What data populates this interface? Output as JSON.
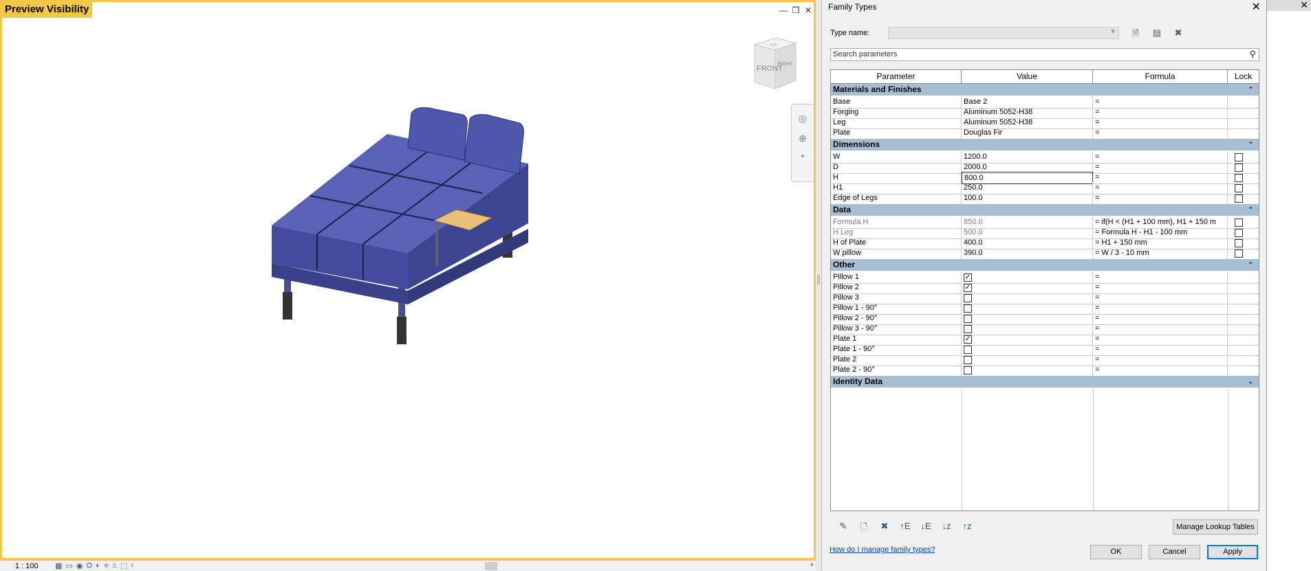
{
  "viewport": {
    "label": "Preview Visibility",
    "controls": [
      "—",
      "❐",
      "✕"
    ],
    "viewcube_front": "FRONT",
    "viewcube_right": "RIGHT",
    "viewcube_top": "TOP"
  },
  "statusbar": {
    "scale": "1 : 100",
    "icons": [
      "▦",
      "▭",
      "◉",
      "⛭",
      "◐",
      "⟡",
      "⌂",
      "⬚",
      "‹"
    ],
    "arrow_right": "›"
  },
  "dialog": {
    "title": "Family Types",
    "close": "✕",
    "type_name_label": "Type name:",
    "type_name_value": "",
    "type_tools": [
      "🗎",
      "▤",
      "✖"
    ],
    "search_placeholder": "Search parameters",
    "headers": {
      "parameter": "Parameter",
      "value": "Value",
      "formula": "Formula",
      "lock": "Lock"
    },
    "groups": [
      {
        "name": "Materials and Finishes",
        "arrow": "⌃",
        "rows": [
          {
            "param": "Base",
            "value": "Base 2",
            "formula": "=",
            "lock": null
          },
          {
            "param": "Forging",
            "value": "Aluminum 5052-H38",
            "formula": "=",
            "lock": null
          },
          {
            "param": "Leg",
            "value": "Aluminum 5052-H38",
            "formula": "=",
            "lock": null
          },
          {
            "param": "Plate",
            "value": "Douglas Fir",
            "formula": "=",
            "lock": null
          }
        ]
      },
      {
        "name": "Dimensions",
        "arrow": "⌃",
        "rows": [
          {
            "param": "W",
            "value": "1200.0",
            "formula": "=",
            "lock": false
          },
          {
            "param": "D",
            "value": "2000.0",
            "formula": "=",
            "lock": false
          },
          {
            "param": "H",
            "value": "800.0",
            "formula": "=",
            "lock": false,
            "editing": true
          },
          {
            "param": "H1",
            "value": "250.0",
            "formula": "=",
            "lock": false
          },
          {
            "param": "Edge of Legs",
            "value": "100.0",
            "formula": "=",
            "lock": false
          }
        ]
      },
      {
        "name": "Data",
        "arrow": "⌃",
        "rows": [
          {
            "param": "Formula H",
            "value": "850.0",
            "formula": "= if(H < (H1 + 100 mm), H1 + 150 m",
            "lock": false,
            "gray": true
          },
          {
            "param": "H Leg",
            "value": "500.0",
            "formula": "= Formula H - H1 - 100 mm",
            "lock": false,
            "gray": true
          },
          {
            "param": "H of Plate",
            "value": "400.0",
            "formula": "= H1 + 150 mm",
            "lock": false
          },
          {
            "param": "W pillow",
            "value": "390.0",
            "formula": "= W / 3 - 10 mm",
            "lock": false
          }
        ]
      },
      {
        "name": "Other",
        "arrow": "⌃",
        "rows": [
          {
            "param": "Pillow 1",
            "check": true,
            "formula": "=",
            "lock": null
          },
          {
            "param": "Pillow 2",
            "check": true,
            "formula": "=",
            "lock": null
          },
          {
            "param": "Pillow 3",
            "check": false,
            "formula": "=",
            "lock": null
          },
          {
            "param": "Pillow 1 - 90°",
            "check": false,
            "formula": "=",
            "lock": null
          },
          {
            "param": "Pillow 2 - 90°",
            "check": false,
            "formula": "=",
            "lock": null
          },
          {
            "param": "Pillow 3 - 90°",
            "check": false,
            "formula": "=",
            "lock": null
          },
          {
            "param": "Plate 1",
            "check": true,
            "formula": "=",
            "lock": null
          },
          {
            "param": "Plate 1 - 90°",
            "check": false,
            "formula": "=",
            "lock": null
          },
          {
            "param": "Plate 2",
            "check": false,
            "formula": "=",
            "lock": null
          },
          {
            "param": "Plate 2 - 90°",
            "check": false,
            "formula": "=",
            "lock": null
          }
        ]
      },
      {
        "name": "Identity Data",
        "arrow": "⌄",
        "rows": []
      }
    ],
    "bottom_tools": [
      "✎",
      "🗋",
      "✖",
      "↑E",
      "↓E",
      "↓z",
      "↑z"
    ],
    "manage_lookup": "Manage Lookup Tables",
    "help_link": "How do I manage family types?",
    "ok": "OK",
    "cancel": "Cancel",
    "apply": "Apply"
  },
  "right_strip": {
    "close": "✕"
  },
  "colors": {
    "viewport_border": "#f2c846",
    "group_header": "#a8bed3",
    "sofa": "#4b54a8",
    "plate": "#e8c07a"
  }
}
